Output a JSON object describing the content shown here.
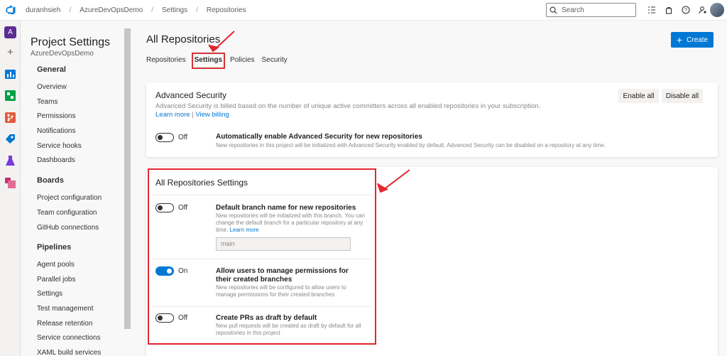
{
  "breadcrumb": [
    "duranhsieh",
    "AzureDevOpsDemo",
    "Settings",
    "Repositories"
  ],
  "search": {
    "placeholder": "Search"
  },
  "rail": {
    "project_initial": "A"
  },
  "nav": {
    "title": "Project Settings",
    "subtitle": "AzureDevOpsDemo",
    "groups": [
      {
        "label": "General",
        "items": [
          "Overview",
          "Teams",
          "Permissions",
          "Notifications",
          "Service hooks",
          "Dashboards"
        ]
      },
      {
        "label": "Boards",
        "items": [
          "Project configuration",
          "Team configuration",
          "GitHub connections"
        ]
      },
      {
        "label": "Pipelines",
        "items": [
          "Agent pools",
          "Parallel jobs",
          "Settings",
          "Test management",
          "Release retention",
          "Service connections",
          "XAML build services"
        ]
      }
    ]
  },
  "main": {
    "title": "All Repositories",
    "create_label": "Create",
    "tabs": [
      "Repositories",
      "Settings",
      "Policies",
      "Security"
    ],
    "selected_tab": "Settings"
  },
  "advanced_security": {
    "title": "Advanced Security",
    "description": "Advanced Security is billed based on the number of unique active committers across all enabled repositories in your subscription.",
    "learn_more": "Learn more",
    "separator": "|",
    "view_billing": "View billing",
    "enable_all": "Enable all",
    "disable_all": "Disable all",
    "toggle_state": "Off",
    "setting_title": "Automatically enable Advanced Security for new repositories",
    "setting_desc": "New repositories in this project will be initialized with Advanced Security enabled by default. Advanced Security can be disabled on a repository at any time."
  },
  "all_repo_settings": {
    "title": "All Repositories Settings",
    "settings": [
      {
        "state": "Off",
        "title": "Default branch name for new repositories",
        "desc": "New repositories will be initialized with this branch. You can change the default branch for a particular repository at any time.",
        "link": "Learn more",
        "input_value": "main"
      },
      {
        "state": "On",
        "title": "Allow users to manage permissions for their created branches",
        "desc": "New repositories will be configured to allow users to manage permissions for their created branches"
      },
      {
        "state": "Off",
        "title": "Create PRs as draft by default",
        "desc": "New pull requests will be created as draft by default for all repositories in this project"
      }
    ]
  },
  "colors": {
    "accent": "#0078d4",
    "annotation_red": "#e3262f",
    "project_purple": "#5c2d91"
  }
}
